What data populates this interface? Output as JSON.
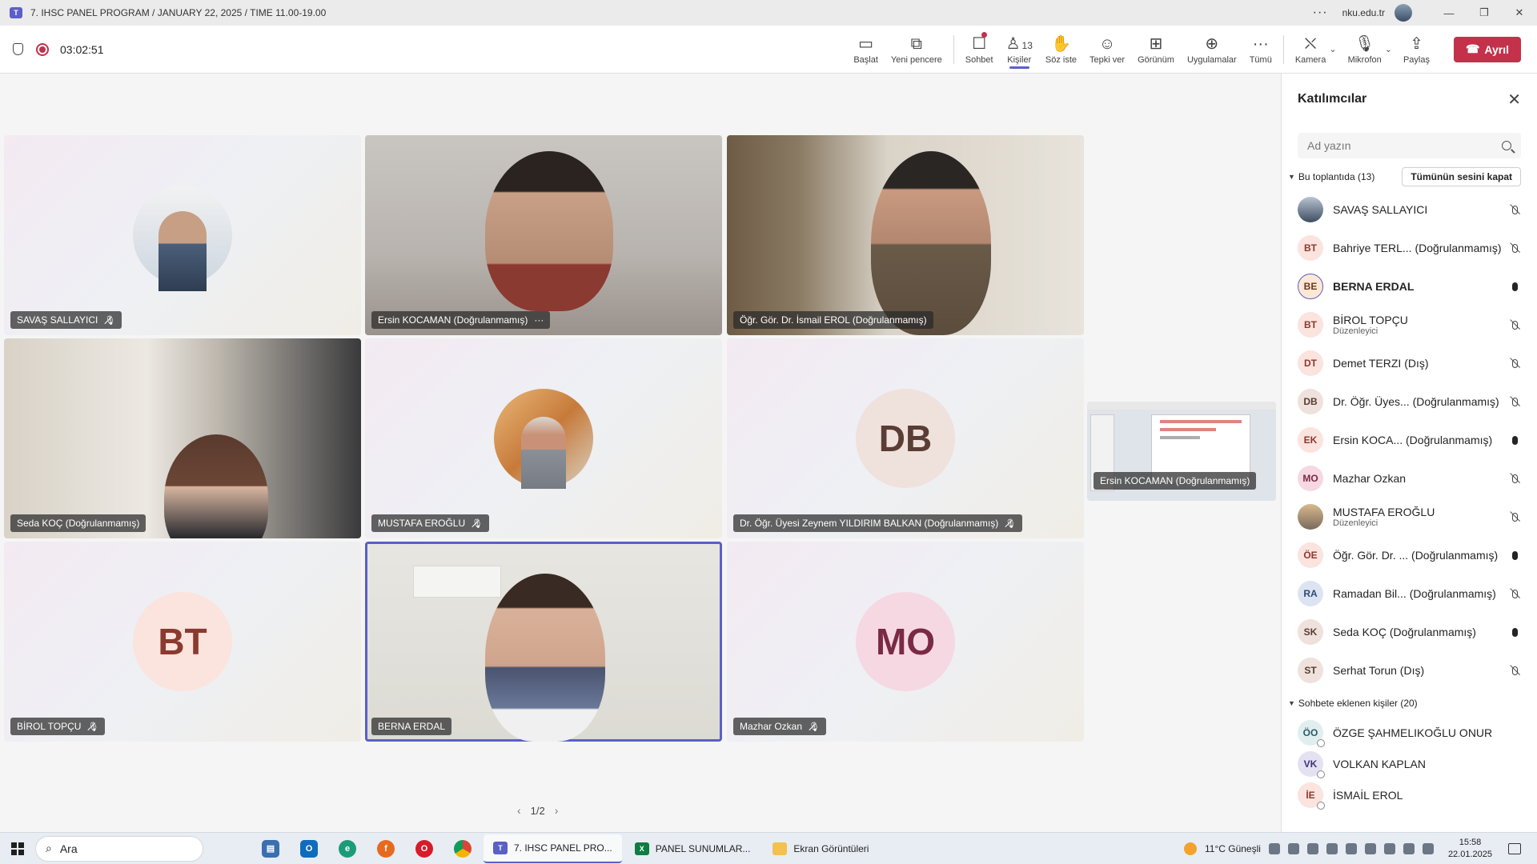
{
  "window": {
    "title": "7. IHSC PANEL PROGRAM / JANUARY 22, 2025 / TIME 11.00-19.00",
    "org": "nku.edu.tr"
  },
  "meeting": {
    "timer": "03:02:51",
    "buttons": {
      "start": "Başlat",
      "new_window": "Yeni pencere",
      "chat": "Sohbet",
      "people": "Kişiler",
      "people_count": "13",
      "raise_hand": "Söz iste",
      "react": "Tepki ver",
      "view": "Görünüm",
      "apps": "Uygulamalar",
      "more": "Tümü",
      "camera": "Kamera",
      "mic": "Mikrofon",
      "share": "Paylaş",
      "leave": "Ayrıl"
    }
  },
  "tiles": [
    {
      "name": "SAVAŞ SALLAYICI"
    },
    {
      "name": "Ersin KOCAMAN (Doğrulanmamış)"
    },
    {
      "name": "Öğr. Gör. Dr. İsmail EROL (Doğrulanmamış)"
    },
    {
      "name": "Seda KOÇ (Doğrulanmamış)"
    },
    {
      "name": "MUSTAFA EROĞLU"
    },
    {
      "name": "Dr. Öğr. Üyesi Zeynem YILDIRIM BALKAN (Doğrulanmamış)",
      "initials": "DB"
    },
    {
      "name": "BİROL TOPÇU",
      "initials": "BT"
    },
    {
      "name": "BERNA ERDAL"
    },
    {
      "name": "Mazhar Ozkan",
      "initials": "MO"
    }
  ],
  "pip": {
    "name": "Ersin KOCAMAN (Doğrulanmamış)"
  },
  "pager": {
    "label": "1/2"
  },
  "panel": {
    "title": "Katılımcılar",
    "search_placeholder": "Ad yazın",
    "in_meeting_label": "Bu toplantıda (13)",
    "mute_all": "Tümünün sesini kapat",
    "participants": [
      {
        "initials": "",
        "name": "SAVAŞ SALLAYICI",
        "role": "",
        "mic": "off"
      },
      {
        "initials": "BT",
        "name": "Bahriye TERL... (Doğrulanmamış)",
        "role": "",
        "mic": "off"
      },
      {
        "initials": "BE",
        "name": "BERNA ERDAL",
        "role": "",
        "mic": "on"
      },
      {
        "initials": "BT",
        "name": "BİROL TOPÇU",
        "role": "Düzenleyici",
        "mic": "off"
      },
      {
        "initials": "DT",
        "name": "Demet TERZI (Dış)",
        "role": "",
        "mic": "off"
      },
      {
        "initials": "DB",
        "name": "Dr. Öğr. Üyes... (Doğrulanmamış)",
        "role": "",
        "mic": "off"
      },
      {
        "initials": "EK",
        "name": "Ersin KOCA...   (Doğrulanmamış)",
        "role": "",
        "mic": "on"
      },
      {
        "initials": "MO",
        "name": "Mazhar Ozkan",
        "role": "",
        "mic": "off"
      },
      {
        "initials": "",
        "name": "MUSTAFA EROĞLU",
        "role": "Düzenleyici",
        "mic": "off"
      },
      {
        "initials": "ÖE",
        "name": "Öğr. Gör. Dr. ... (Doğrulanmamış)",
        "role": "",
        "mic": "on"
      },
      {
        "initials": "RA",
        "name": "Ramadan Bil... (Doğrulanmamış)",
        "role": "",
        "mic": "off"
      },
      {
        "initials": "SK",
        "name": "Seda KOÇ (Doğrulanmamış)",
        "role": "",
        "mic": "on"
      },
      {
        "initials": "ST",
        "name": "Serhat Torun (Dış)",
        "role": "",
        "mic": "off"
      }
    ],
    "chat_added_label": "Sohbete eklenen kişiler (20)",
    "chat_people": [
      {
        "initials": "ÖO",
        "name": "ÖZGE ŞAHMELIKOĞLU ONUR"
      },
      {
        "initials": "VK",
        "name": "VOLKAN KAPLAN"
      },
      {
        "initials": "İE",
        "name": "İSMAİL EROL"
      }
    ]
  },
  "taskbar": {
    "search": "Ara",
    "tasks": [
      {
        "label": "7. IHSC PANEL PRO..."
      },
      {
        "label": "PANEL SUNUMLAR..."
      },
      {
        "label": "Ekran Görüntüleri"
      }
    ],
    "weather": "11°C  Güneşli",
    "time": "15:58",
    "date": "22.01.2025"
  }
}
